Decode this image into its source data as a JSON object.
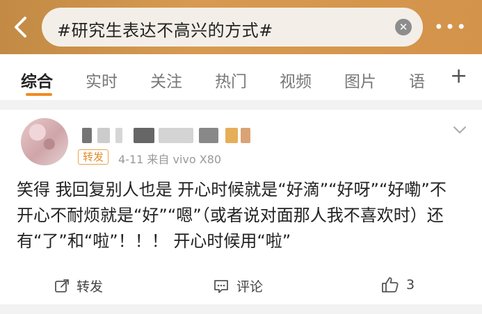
{
  "search": {
    "query": "#研究生表达不高兴的方式#"
  },
  "tabs": [
    {
      "label": "综合",
      "active": true
    },
    {
      "label": "实时"
    },
    {
      "label": "关注"
    },
    {
      "label": "热门"
    },
    {
      "label": "视频"
    },
    {
      "label": "图片"
    },
    {
      "label": "语"
    }
  ],
  "post": {
    "badge": "转发",
    "date_source": "4-11 来自 vivo X80",
    "content": "笑得 我回复别人也是 开心时候就是“好滴”“好呀”“好嘞”不开心不耐烦就是“好”“嗯”（或者说对面那人我不喜欢时）还有“了”和“啦”！！！ 开心时候用“啦”",
    "actions": {
      "repost_label": "转发",
      "comment_label": "评论",
      "like_count": "3"
    }
  },
  "colors": {
    "header": "#d4934a",
    "accent": "#f08c1e"
  }
}
